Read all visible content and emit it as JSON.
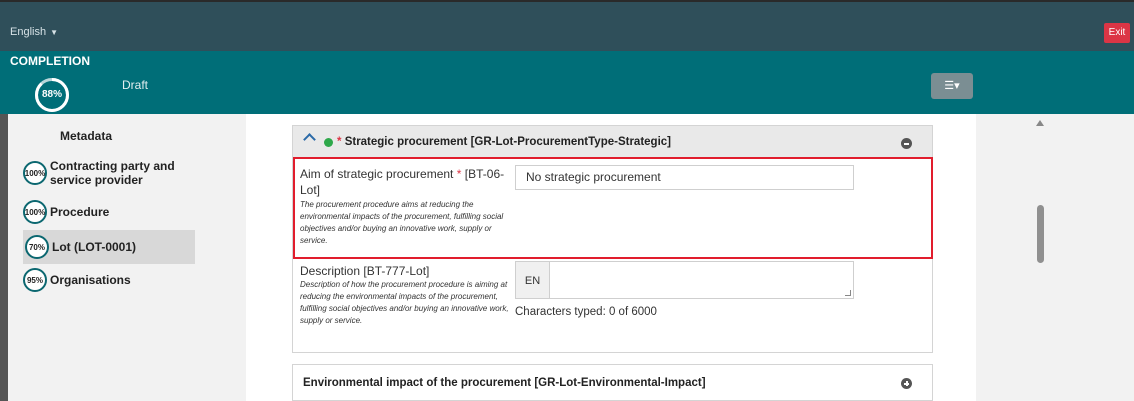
{
  "header": {
    "language": "English",
    "exit_label": "Exit"
  },
  "completion": {
    "title": "COMPLETION",
    "percent": "88%",
    "percent_value": 88,
    "status": "Draft"
  },
  "toolbar": {
    "filter_icon": "sliders-icon"
  },
  "sidebar": {
    "title": "Metadata",
    "items": [
      {
        "badge": "100%",
        "label": "Contracting party and service provider",
        "active": false
      },
      {
        "badge": "100%",
        "label": "Procedure",
        "active": false
      },
      {
        "badge": "70%",
        "label": "Lot (LOT-0001)",
        "active": true
      },
      {
        "badge": "95%",
        "label": "Organisations",
        "active": false
      }
    ]
  },
  "section": {
    "title": "Strategic procurement  [GR-Lot-ProcurementType-Strategic]",
    "required_mark": "*"
  },
  "field_aim": {
    "label": "Aim of strategic procurement",
    "required_mark": "*",
    "code": "[BT-06-Lot]",
    "help": "The procurement procedure aims at reducing the environmental impacts of the procurement, fulfilling social objectives and/or buying an innovative work, supply or service.",
    "value": "No strategic procurement"
  },
  "field_description": {
    "label": "Description [BT-777-Lot]",
    "help": "Description of how the procurement procedure is aiming at reducing the environmental impacts of the procurement, fulfilling social objectives and/or buying an innovative work, supply or service.",
    "language_tag": "EN",
    "counter": "Characters typed: 0 of 6000"
  },
  "section_env": {
    "title": "Environmental impact of the procurement  [GR-Lot-Environmental-Impact]"
  }
}
